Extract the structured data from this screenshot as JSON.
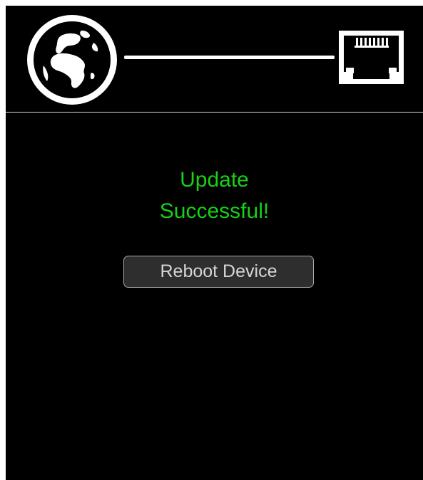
{
  "header": {
    "left_icon": "globe-icon",
    "right_icon": "ethernet-port-icon"
  },
  "status": {
    "line1": "Update",
    "line2": "Successful!",
    "color": "#17d017"
  },
  "actions": {
    "reboot_label": "Reboot Device"
  },
  "colors": {
    "background": "#000000",
    "icon": "#ffffff",
    "button_bg": "#2e2e2e",
    "button_border": "#a9a9a9"
  }
}
